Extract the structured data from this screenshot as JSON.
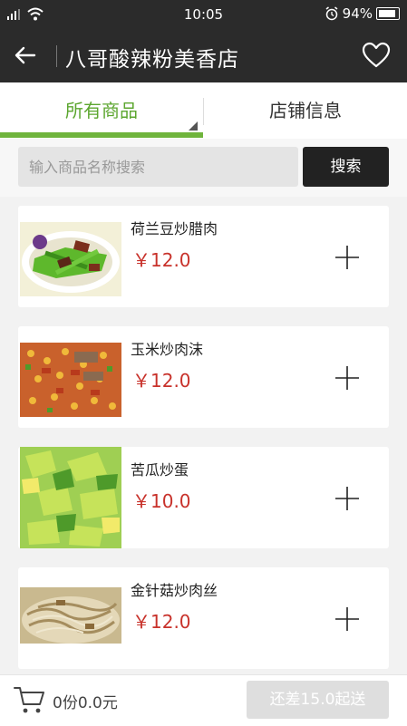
{
  "status_bar": {
    "time": "10:05",
    "battery": "94%"
  },
  "header": {
    "title": "八哥酸辣粉美香店"
  },
  "tabs": [
    {
      "label": "所有商品",
      "active": true
    },
    {
      "label": "店铺信息",
      "active": false
    }
  ],
  "search": {
    "placeholder": "输入商品名称搜索",
    "button_label": "搜索"
  },
  "products": [
    {
      "name": "荷兰豆炒腊肉",
      "price": "￥12.0"
    },
    {
      "name": "玉米炒肉沫",
      "price": "￥12.0"
    },
    {
      "name": "苦瓜炒蛋",
      "price": "￥10.0"
    },
    {
      "name": "金针菇炒肉丝",
      "price": "￥12.0"
    }
  ],
  "cart": {
    "summary": "0份0.0元",
    "min_order_label": "还差15.0起送"
  },
  "colors": {
    "accent": "#6fb43c",
    "price": "#c8322b",
    "header_bg": "#2b2b2b"
  }
}
